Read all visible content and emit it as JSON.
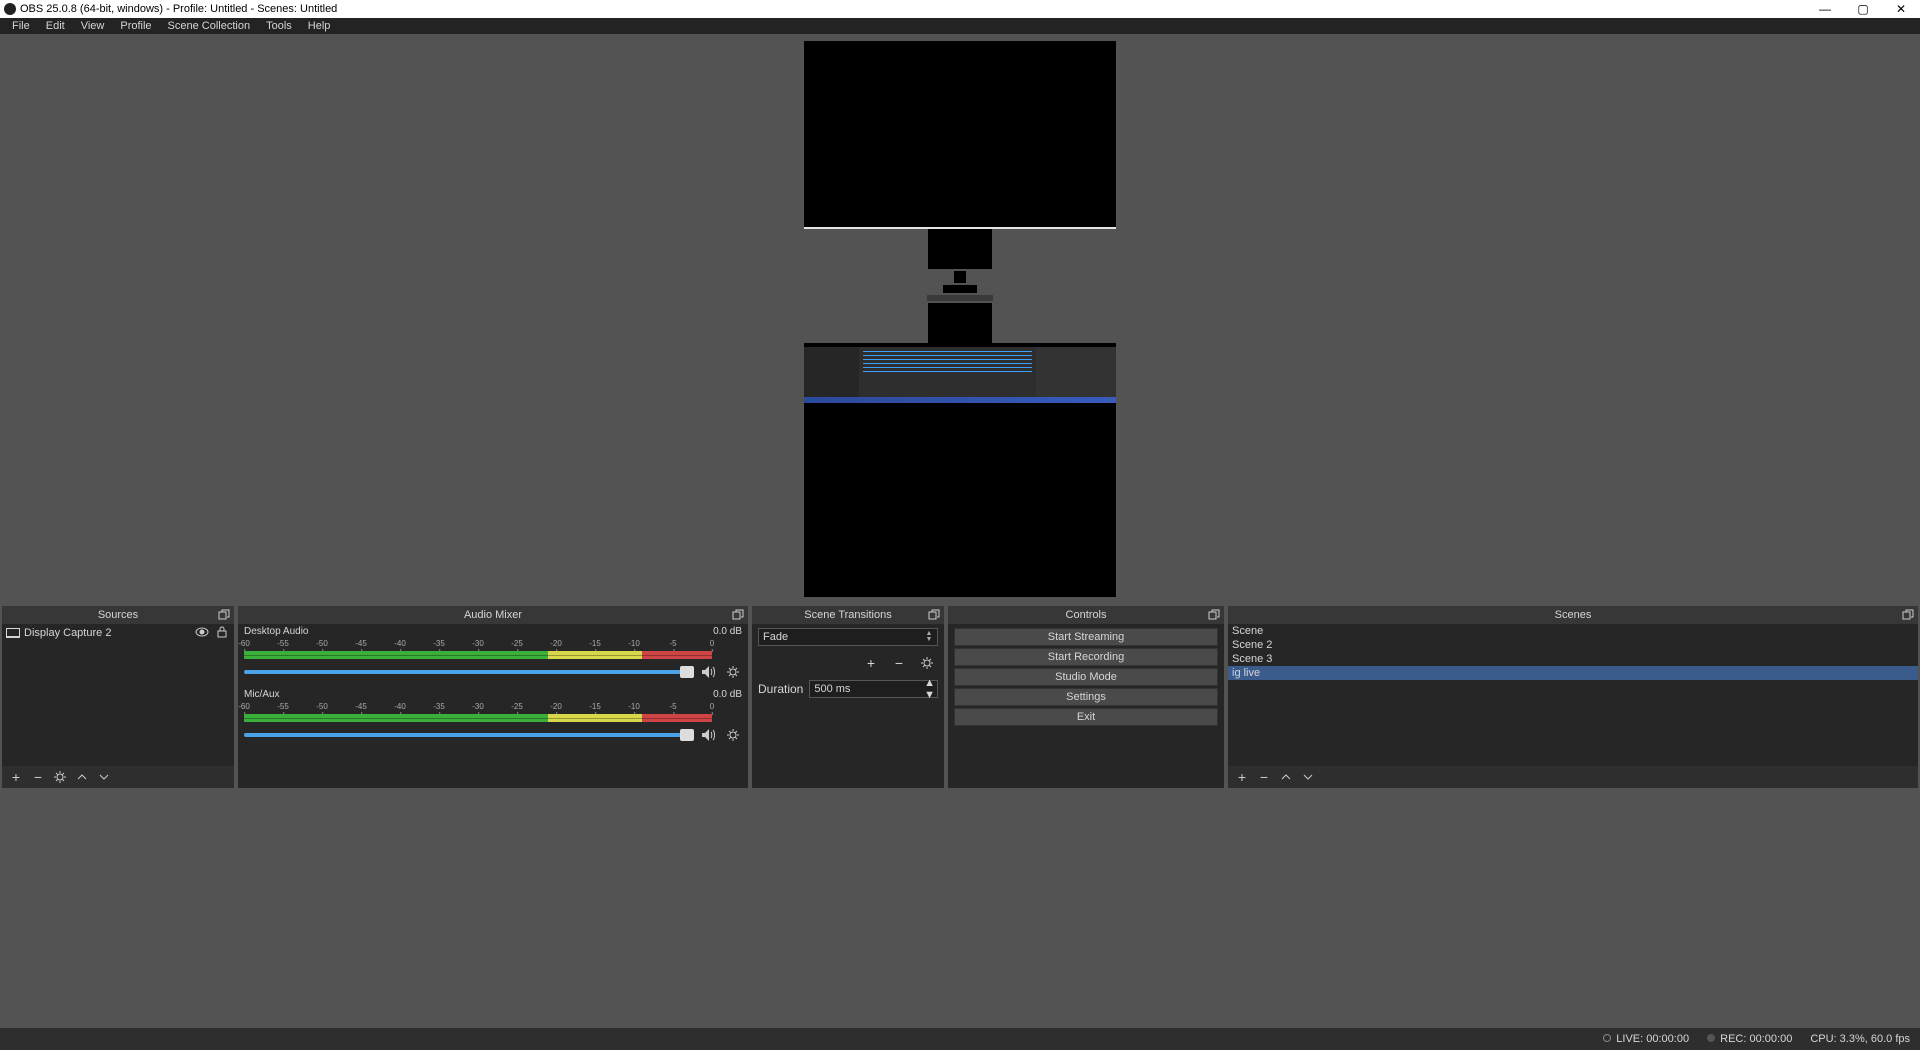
{
  "window": {
    "title": "OBS 25.0.8 (64-bit, windows) - Profile: Untitled - Scenes: Untitled"
  },
  "menu": {
    "items": [
      "File",
      "Edit",
      "View",
      "Profile",
      "Scene Collection",
      "Tools",
      "Help"
    ]
  },
  "docks": {
    "sources": {
      "title": "Sources",
      "items": [
        {
          "icon": "monitor",
          "label": "Display Capture 2",
          "visible": true,
          "locked": false
        }
      ]
    },
    "mixer": {
      "title": "Audio Mixer",
      "scale_ticks": [
        "-60",
        "-55",
        "-50",
        "-45",
        "-40",
        "-35",
        "-30",
        "-25",
        "-20",
        "-15",
        "-10",
        "-5",
        "0"
      ],
      "channels": [
        {
          "name": "Desktop Audio",
          "level": "0.0 dB"
        },
        {
          "name": "Mic/Aux",
          "level": "0.0 dB"
        }
      ]
    },
    "transitions": {
      "title": "Scene Transitions",
      "current": "Fade",
      "duration_label": "Duration",
      "duration_value": "500 ms"
    },
    "controls": {
      "title": "Controls",
      "buttons": [
        "Start Streaming",
        "Start Recording",
        "Studio Mode",
        "Settings",
        "Exit"
      ]
    },
    "scenes": {
      "title": "Scenes",
      "items": [
        "Scene",
        "Scene 2",
        "Scene 3",
        "ig live"
      ],
      "selected": 3
    }
  },
  "status": {
    "live_label": "LIVE:",
    "live_time": "00:00:00",
    "rec_label": "REC:",
    "rec_time": "00:00:00",
    "cpu": "CPU: 3.3%, 60.0 fps"
  }
}
